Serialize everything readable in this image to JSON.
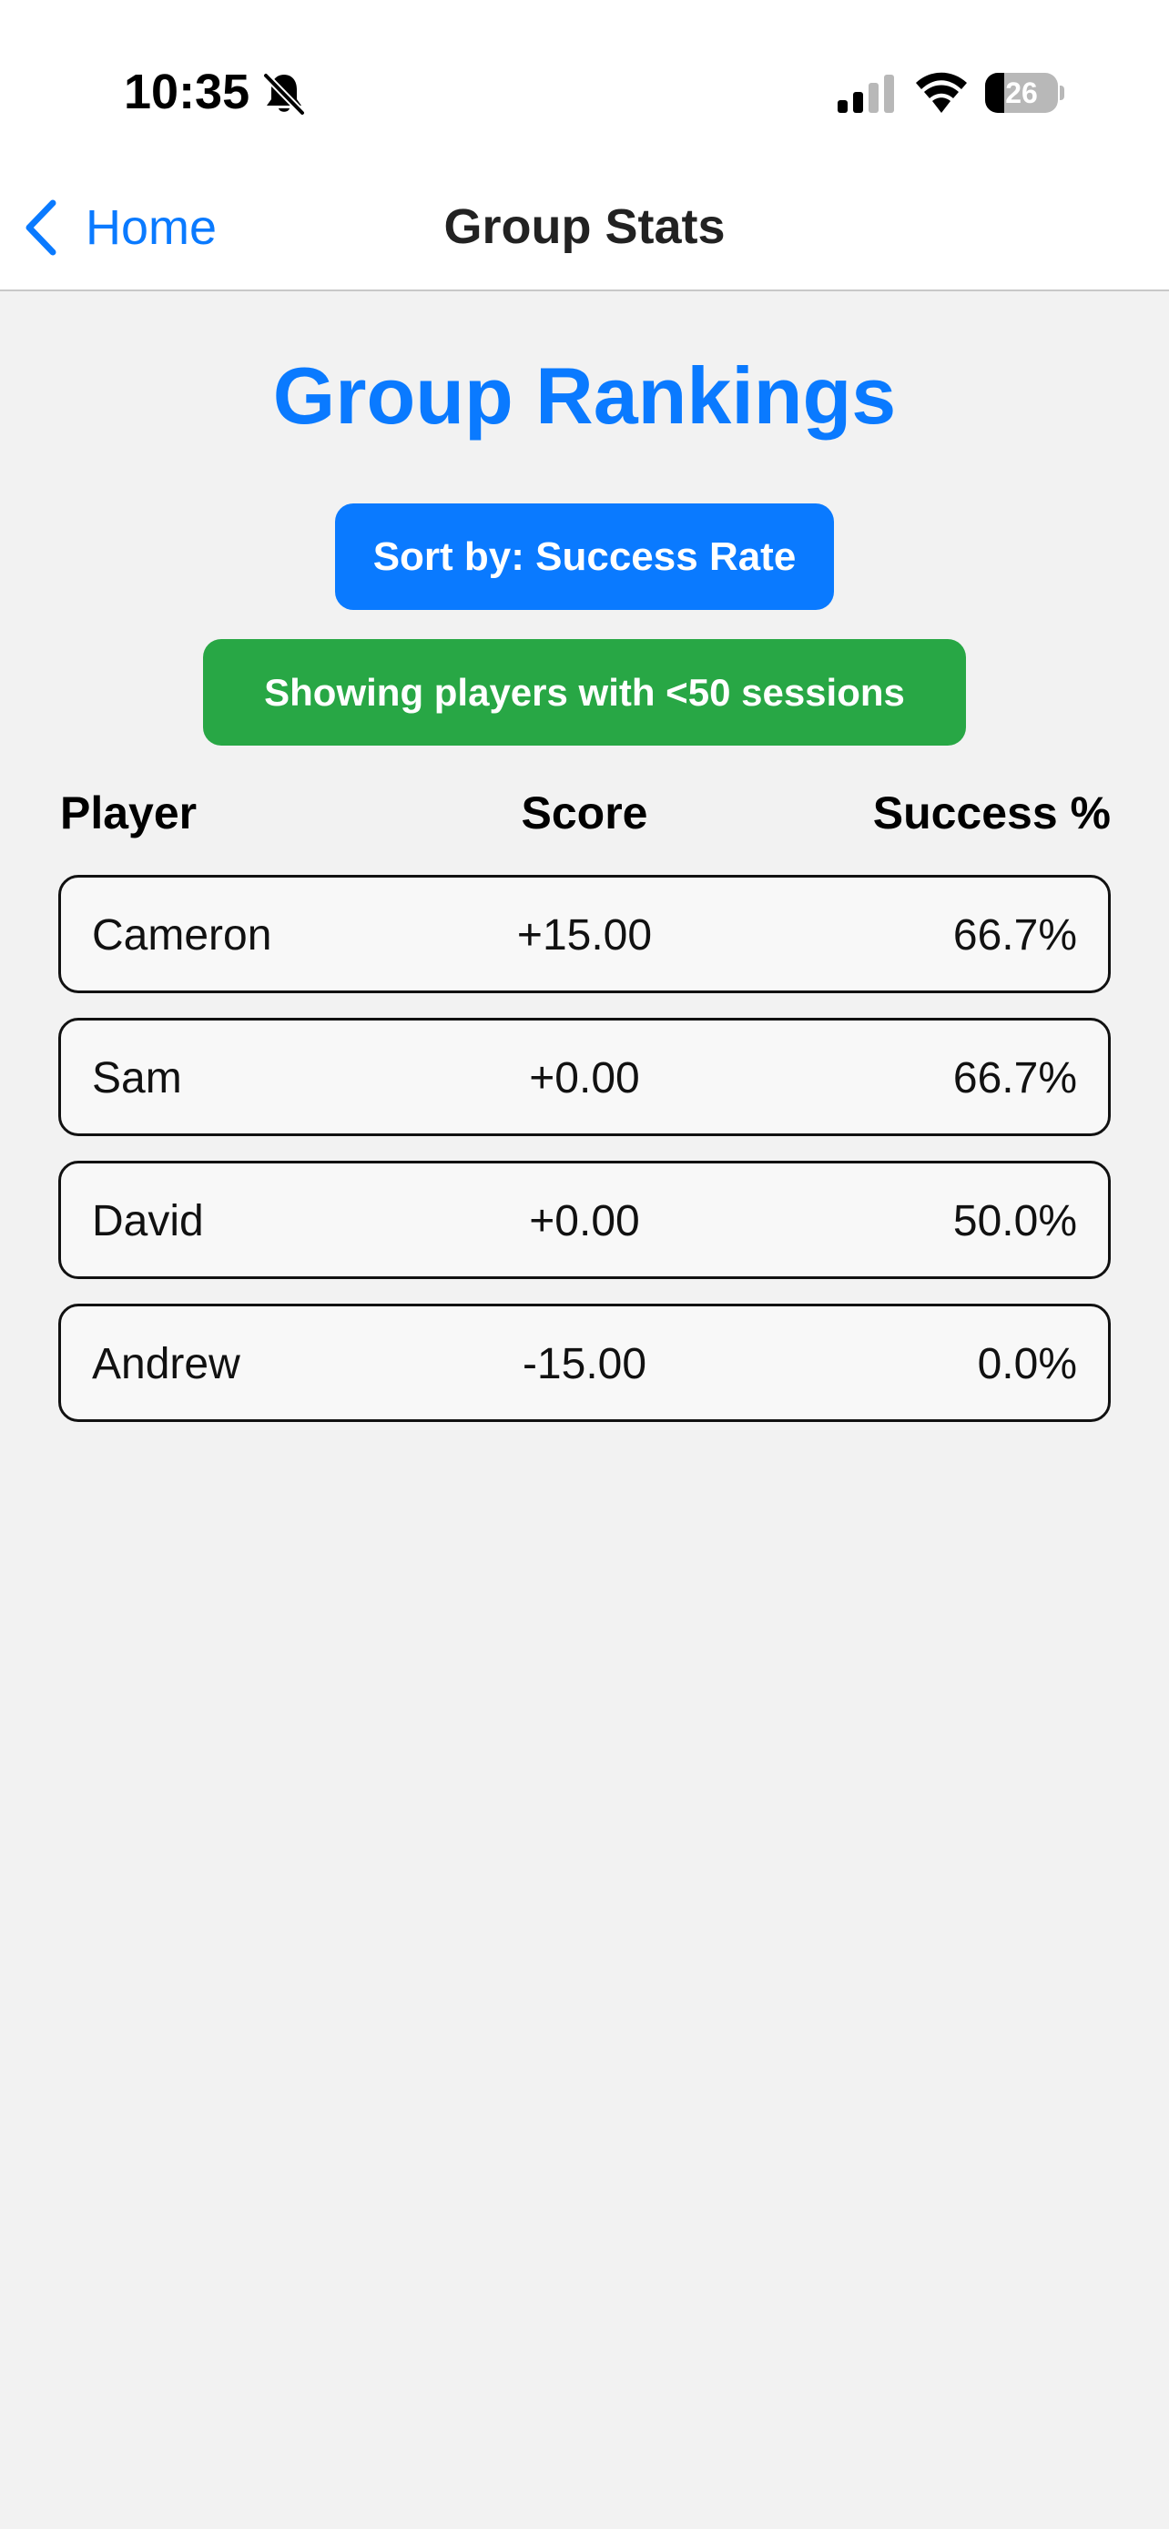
{
  "status_bar": {
    "time": "10:35",
    "battery_level": "26",
    "battery_fraction": 0.26,
    "icons": [
      "bell-slash-icon",
      "signal-icon",
      "wifi-icon",
      "battery-icon"
    ]
  },
  "nav": {
    "back_label": "Home",
    "back_icon": "chevron-left-icon",
    "title": "Group Stats"
  },
  "main": {
    "heading": "Group Rankings",
    "sort_label": "Sort by: Success Rate",
    "filter_label": "Showing players with <50 sessions"
  },
  "table": {
    "headers": {
      "player": "Player",
      "score": "Score",
      "success": "Success %"
    },
    "rows": [
      {
        "player": "Cameron",
        "score": "+15.00",
        "success": "66.7%"
      },
      {
        "player": "Sam",
        "score": "+0.00",
        "success": "66.7%"
      },
      {
        "player": "David",
        "score": "+0.00",
        "success": "50.0%"
      },
      {
        "player": "Andrew",
        "score": "-15.00",
        "success": "0.0%"
      }
    ]
  },
  "colors": {
    "accent": "#0a7aff",
    "filter_green": "#28a745",
    "background": "#f2f2f2",
    "row_background": "#f8f8f8"
  }
}
